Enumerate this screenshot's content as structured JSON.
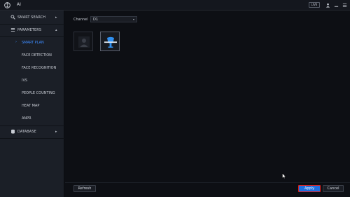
{
  "window": {
    "title": "AI",
    "live_label": "LIVE"
  },
  "sidebar": {
    "items": [
      {
        "label": "SMART SEARCH",
        "arrow": "▸"
      },
      {
        "label": "PARAMETERS",
        "arrow": "▴"
      },
      {
        "label": "DATABASE",
        "arrow": "▸"
      }
    ],
    "subitems": [
      {
        "label": "SMART PLAN",
        "active": true
      },
      {
        "label": "FACE DETECTION"
      },
      {
        "label": "FACE RECOGNITION"
      },
      {
        "label": "IVS"
      },
      {
        "label": "PEOPLE COUNTING"
      },
      {
        "label": "HEAT MAP"
      },
      {
        "label": "ANPR"
      }
    ]
  },
  "main": {
    "channel_label": "Channel",
    "channel_value": "D1",
    "plans": [
      {
        "icon": "face-recognition-plan-icon",
        "enabled": false
      },
      {
        "icon": "ivs-plan-icon",
        "enabled": true
      }
    ]
  },
  "footer": {
    "refresh_label": "Refresh",
    "apply_label": "Apply",
    "cancel_label": "Cancel"
  },
  "colors": {
    "accent": "#3d8cff",
    "apply_fill": "#1f6fe0",
    "highlight_border": "#e0231f",
    "sidebar_bg": "#1b1f27",
    "main_bg": "#0d0f14"
  }
}
